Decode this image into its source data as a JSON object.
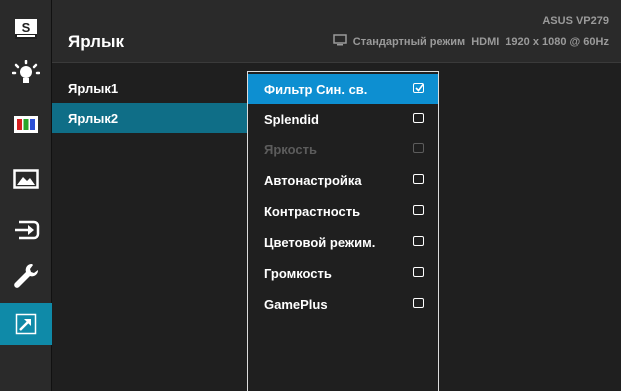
{
  "header": {
    "title": "Ярлык",
    "model": "ASUS VP279",
    "mode": "Стандартный режим",
    "input": "HDMI",
    "resolution": "1920 x 1080 @ 60Hz"
  },
  "sidebar": {
    "items": [
      {
        "icon": "splendid-s-icon"
      },
      {
        "icon": "blue-light-filter-icon"
      },
      {
        "icon": "color-icon"
      },
      {
        "icon": "image-icon"
      },
      {
        "icon": "input-select-icon"
      },
      {
        "icon": "system-setup-wrench-icon"
      },
      {
        "icon": "shortcut-arrow-icon",
        "active": true
      }
    ]
  },
  "shortcuts": [
    {
      "label": "Ярлык1"
    },
    {
      "label": "Ярлык2",
      "selected": true
    }
  ],
  "options": [
    {
      "label": "Фильтр Син. св.",
      "checked": true,
      "highlighted": true
    },
    {
      "label": "Splendid",
      "checked": false
    },
    {
      "label": "Яркость",
      "checked": false,
      "disabled": true
    },
    {
      "label": "Автонастройка",
      "checked": false
    },
    {
      "label": "Контрастность",
      "checked": false
    },
    {
      "label": "Цветовой режим.",
      "checked": false
    },
    {
      "label": "Громкость",
      "checked": false
    },
    {
      "label": "GamePlus",
      "checked": false
    }
  ],
  "colors": {
    "accent": "#0d8fd1",
    "selected": "#0f6e87",
    "active_sidebar": "#0f8aa8",
    "background": "#1f1f1f"
  }
}
